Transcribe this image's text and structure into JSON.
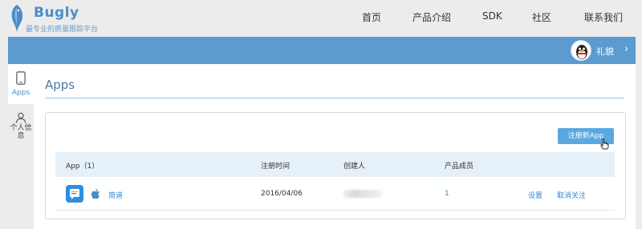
{
  "brand": {
    "title": "Bugly",
    "subtitle": "最专业的质量跟踪平台"
  },
  "topnav": {
    "items": [
      {
        "label": "首页"
      },
      {
        "label": "产品介绍"
      },
      {
        "label": "SDK"
      },
      {
        "label": "社区"
      },
      {
        "label": "联系我们"
      }
    ]
  },
  "user": {
    "name": "礼貌",
    "chevron": "›"
  },
  "sidebar": {
    "items": [
      {
        "label": "Apps",
        "icon": "phone-icon",
        "active": true
      },
      {
        "label": "个人信息",
        "icon": "user-icon",
        "active": false
      }
    ]
  },
  "main": {
    "title": "Apps",
    "register_button": "注册新App",
    "table": {
      "headers": [
        "App（1）",
        "注册时间",
        "创建人",
        "产品成员"
      ],
      "rows": [
        {
          "app_name": "简道",
          "platform": "apple-icon",
          "registered": "2016/04/06",
          "creator": "",
          "members": "1",
          "actions": [
            "设置",
            "取消关注"
          ]
        }
      ]
    }
  },
  "colors": {
    "accent": "#5b9bcf",
    "link": "#3a86c8",
    "header_row": "#e6f0f8",
    "button": "#5aa8e0"
  }
}
